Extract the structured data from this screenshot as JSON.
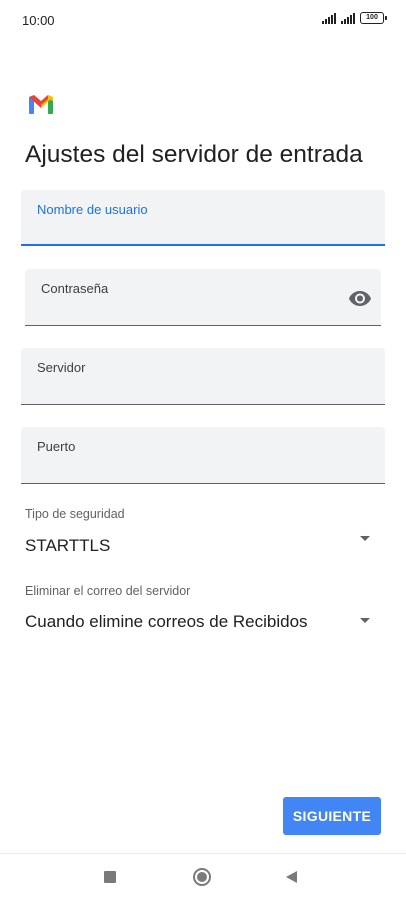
{
  "status_bar": {
    "time": "10:00",
    "battery_level": "100"
  },
  "page": {
    "title": "Ajustes del servidor de entrada",
    "logo_icon": "gmail-logo-icon"
  },
  "fields": {
    "username": {
      "label": "Nombre de usuario",
      "value": ""
    },
    "password": {
      "label": "Contraseña",
      "value": "",
      "toggle_icon": "eye-icon"
    },
    "server": {
      "label": "Servidor",
      "value": ""
    },
    "port": {
      "label": "Puerto",
      "value": ""
    }
  },
  "dropdowns": {
    "security_type": {
      "label": "Tipo de seguridad",
      "value": "STARTTLS"
    },
    "delete_from_server": {
      "label": "Eliminar el correo del servidor",
      "value": "Cuando elimine correos de Recibidos"
    }
  },
  "actions": {
    "next_label": "SIGUIENTE"
  },
  "colors": {
    "accent": "#1a73e8",
    "button": "#4285f4",
    "field_background": "#f1f3f4",
    "text": "#202124"
  },
  "nav_bar": {
    "icons": [
      "recents-square-icon",
      "home-circle-icon",
      "back-triangle-icon"
    ]
  }
}
